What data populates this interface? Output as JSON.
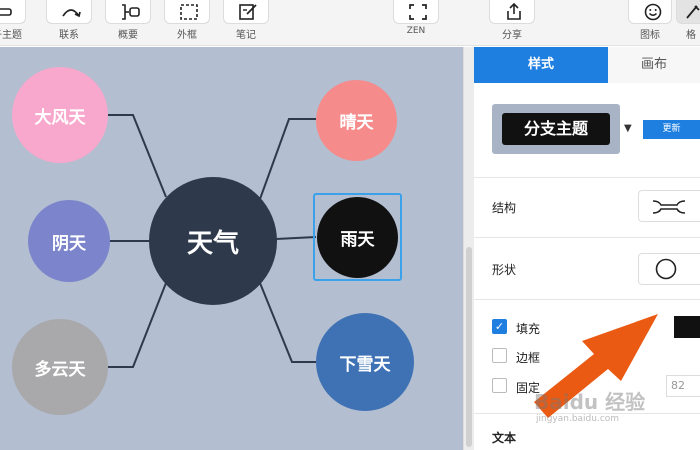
{
  "toolbar": {
    "items": [
      {
        "label": "子主题",
        "icon": "add-subtopic-icon"
      },
      {
        "label": "联系",
        "icon": "relationship-icon"
      },
      {
        "label": "概要",
        "icon": "summary-icon"
      },
      {
        "label": "外框",
        "icon": "boundary-icon"
      },
      {
        "label": "笔记",
        "icon": "notes-icon"
      },
      {
        "label": "ZEN",
        "icon": "fullscreen-icon"
      },
      {
        "label": "分享",
        "icon": "share-icon"
      },
      {
        "label": "图标",
        "icon": "emoji-icon"
      },
      {
        "label": "格",
        "icon": "format-icon"
      }
    ]
  },
  "mindmap": {
    "center": {
      "label": "天气",
      "color": "#2e3a4b"
    },
    "branches": [
      {
        "label": "大风天",
        "color": "#f7a8cc"
      },
      {
        "label": "阴天",
        "color": "#7c85cc"
      },
      {
        "label": "多云天",
        "color": "#a9a9ab"
      },
      {
        "label": "晴天",
        "color": "#f58b8b"
      },
      {
        "label": "雨天",
        "color": "#111111"
      },
      {
        "label": "下雪天",
        "color": "#3f72b5"
      }
    ],
    "canvas_color": "#b3bed0",
    "selected": "雨天"
  },
  "panel": {
    "tabs": {
      "style": "样式",
      "canvas": "画布"
    },
    "preview": {
      "label": "分支主题",
      "update": "更新"
    },
    "structure": {
      "label": "结构"
    },
    "shape": {
      "label": "形状"
    },
    "fill": {
      "label": "填充",
      "checked": true,
      "color": "#111111"
    },
    "border": {
      "label": "边框",
      "checked": false
    },
    "fixed": {
      "label": "固定",
      "checked": false,
      "value": "82"
    },
    "text": {
      "label": "文本"
    }
  },
  "watermark": {
    "main": "Baidu 经验",
    "sub": "jingyan.baidu.com"
  },
  "accent": "#1f7fe0",
  "arrow_color": "#ea5a13"
}
